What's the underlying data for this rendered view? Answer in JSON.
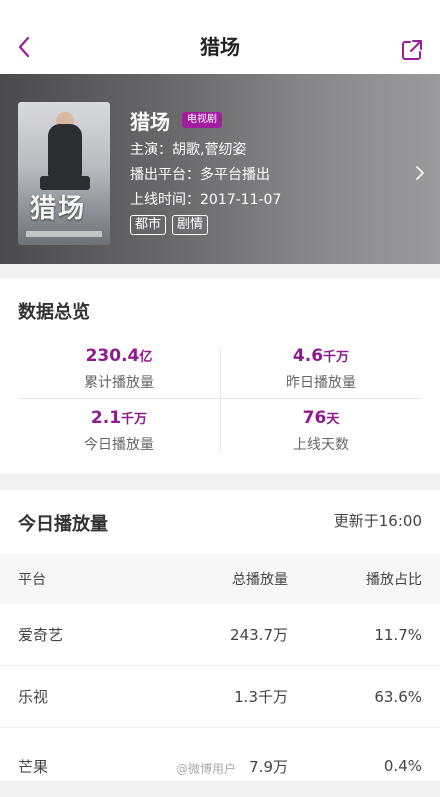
{
  "nav": {
    "title": "猎场",
    "back_icon": "chevron-left-icon",
    "share_icon": "share-icon"
  },
  "show": {
    "title": "猎场",
    "type_badge": "电视剧",
    "cast": "主演：胡歌,菅纫姿",
    "platform": "播出平台：多平台播出",
    "release": "上线时间：2017-11-07",
    "tags": [
      "都市",
      "剧情"
    ],
    "poster_text": "猎场"
  },
  "overview": {
    "title": "数据总览",
    "stats": [
      {
        "value": "230.4",
        "unit": "亿",
        "label": "累计播放量"
      },
      {
        "value": "4.6",
        "unit": "千万",
        "label": "昨日播放量"
      },
      {
        "value": "2.1",
        "unit": "千万",
        "label": "今日播放量"
      },
      {
        "value": "76",
        "unit": "天",
        "label": "上线天数"
      }
    ]
  },
  "today": {
    "title": "今日播放量",
    "updated": "更新于16:00",
    "columns": [
      "平台",
      "总播放量",
      "播放占比"
    ],
    "rows": [
      {
        "platform": "爱奇艺",
        "total": "243.7万",
        "share": "11.7%"
      },
      {
        "platform": "乐视",
        "total": "1.3千万",
        "share": "63.6%"
      },
      {
        "platform": "芒果",
        "total": "7.9万",
        "share": "0.4%"
      }
    ]
  },
  "watermark": "@微博用户",
  "colors": {
    "accent": "#8f1a8d",
    "badge": "#a01e9e"
  }
}
